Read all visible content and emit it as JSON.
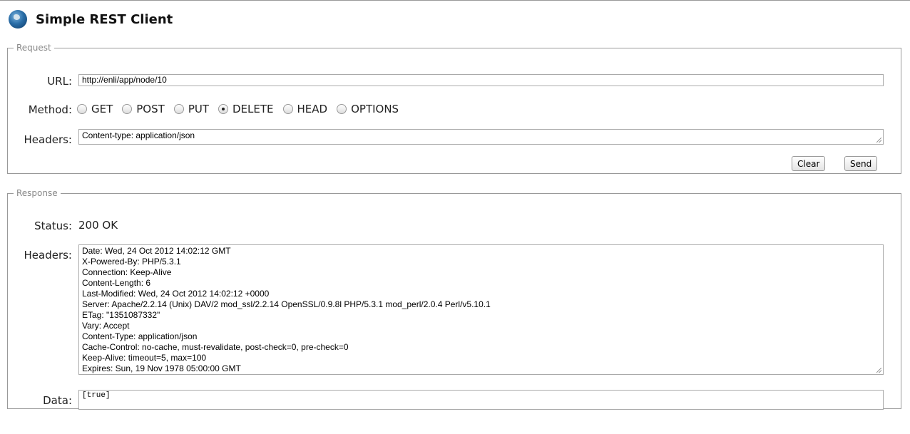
{
  "app": {
    "title": "Simple REST Client",
    "icon": "globe-icon"
  },
  "request": {
    "legend": "Request",
    "url_label": "URL:",
    "url_value": "http://enli/app/node/10",
    "method_label": "Method:",
    "methods": [
      {
        "label": "GET",
        "selected": false
      },
      {
        "label": "POST",
        "selected": false
      },
      {
        "label": "PUT",
        "selected": false
      },
      {
        "label": "DELETE",
        "selected": true
      },
      {
        "label": "HEAD",
        "selected": false
      },
      {
        "label": "OPTIONS",
        "selected": false
      }
    ],
    "headers_label": "Headers:",
    "headers_value": "Content-type: application/json",
    "clear_label": "Clear",
    "send_label": "Send"
  },
  "response": {
    "legend": "Response",
    "status_label": "Status:",
    "status_value": "200 OK",
    "headers_label": "Headers:",
    "headers_lines": [
      "Date: Wed, 24 Oct 2012 14:02:12 GMT",
      "X-Powered-By: PHP/5.3.1",
      "Connection: Keep-Alive",
      "Content-Length: 6",
      "Last-Modified: Wed, 24 Oct 2012 14:02:12 +0000",
      "Server: Apache/2.2.14 (Unix) DAV/2 mod_ssl/2.2.14 OpenSSL/0.9.8l PHP/5.3.1 mod_perl/2.0.4 Perl/v5.10.1",
      "ETag: \"1351087332\"",
      "Vary: Accept",
      "Content-Type: application/json",
      "Cache-Control: no-cache, must-revalidate, post-check=0, pre-check=0",
      "Keep-Alive: timeout=5, max=100",
      "Expires: Sun, 19 Nov 1978 05:00:00 GMT"
    ],
    "data_label": "Data:",
    "data_value": "[true]"
  }
}
